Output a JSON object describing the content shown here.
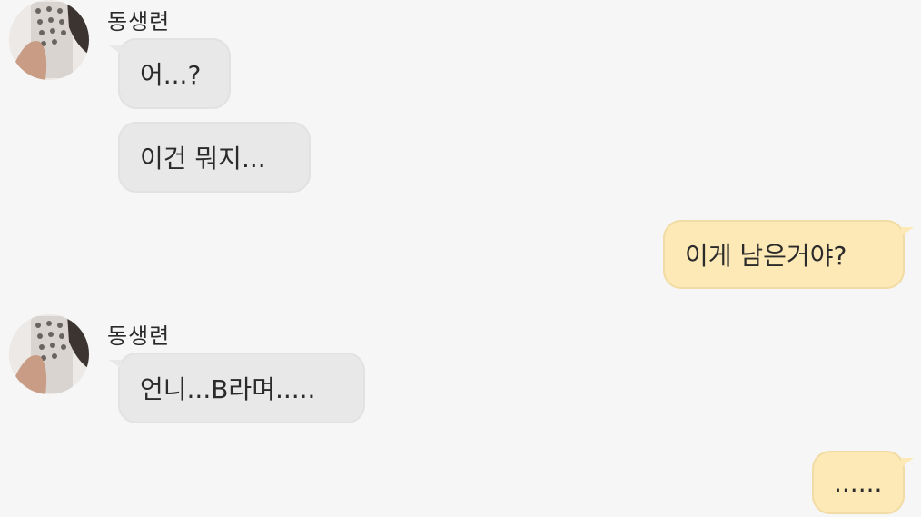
{
  "messages": [
    {
      "sender": "동생련",
      "text": "어...?"
    },
    {
      "text": "이건 뭐지..."
    },
    {
      "text": "이게 남은거야?"
    },
    {
      "sender": "동생련",
      "text": "언니...B라며....."
    },
    {
      "text": "......"
    }
  ],
  "colors": {
    "incoming_bubble": "#e8e8e8",
    "outgoing_bubble": "#fde9b6",
    "background": "#f6f6f6"
  }
}
